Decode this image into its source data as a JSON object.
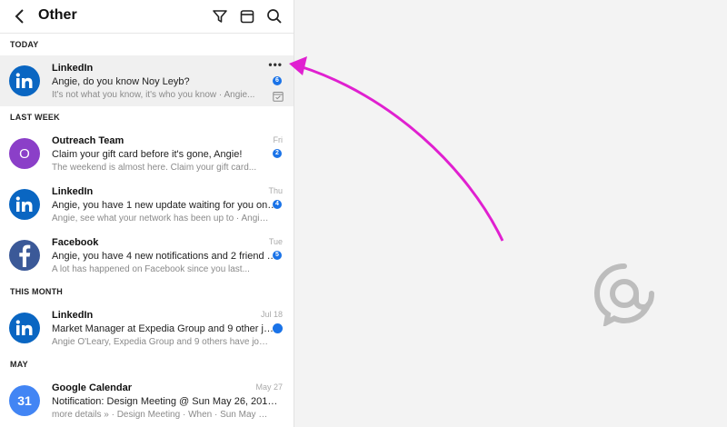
{
  "header": {
    "title": "Other",
    "icons": [
      "back-chevron-icon",
      "filter-icon",
      "calendar-icon",
      "search-icon"
    ]
  },
  "sections": {
    "today": "TODAY",
    "last_week": "LAST WEEK",
    "this_month": "THIS MONTH",
    "may": "MAY"
  },
  "messages": [
    {
      "sender": "LinkedIn",
      "subject": "Angie, do you know Noy Leyb?",
      "preview": "It's not what you know, it's who you know · Angie...",
      "badge": "6",
      "date": "",
      "avatar": "in",
      "avatar_color": "#0a66c2"
    },
    {
      "sender": "Outreach Team",
      "subject": "Claim your gift card before it's gone, Angie!",
      "preview": "The weekend is almost here. Claim your gift card...",
      "badge": "2",
      "date": "Fri",
      "avatar": "O",
      "avatar_color": "#8b3fc8"
    },
    {
      "sender": "LinkedIn",
      "subject": "Angie, you have 1 new update waiting for you on Lin...",
      "preview": "Angie, see what your network has been up to · Angie...",
      "badge": "4",
      "date": "Thu",
      "avatar": "in",
      "avatar_color": "#0a66c2"
    },
    {
      "sender": "Facebook",
      "subject": "Angie, you have 4 new notifications and 2 friend req...",
      "preview": "A lot has happened on Facebook since you last...",
      "badge": "5",
      "date": "Tue",
      "avatar": "f",
      "avatar_color": "#3b5998"
    },
    {
      "sender": "LinkedIn",
      "subject": "Market Manager at Expedia Group and 9 other jobs ...",
      "preview": "Angie O'Leary, Expedia Group and 9 others have job...",
      "badge": "",
      "date": "Jul 18",
      "avatar": "in",
      "avatar_color": "#0a66c2"
    },
    {
      "sender": "Google Calendar",
      "subject": "Notification: Design Meeting @ Sun May 26, 2019 4pm ...",
      "preview": "more details » · Design Meeting · When · Sun May 26,...",
      "badge": "",
      "date": "May 27",
      "avatar": "31",
      "avatar_color": "#4285f4"
    }
  ],
  "more_label": "•••",
  "colors": {
    "accent": "#1a73e8",
    "arrow": "#e020d0",
    "logo": "#bdbdbd"
  }
}
